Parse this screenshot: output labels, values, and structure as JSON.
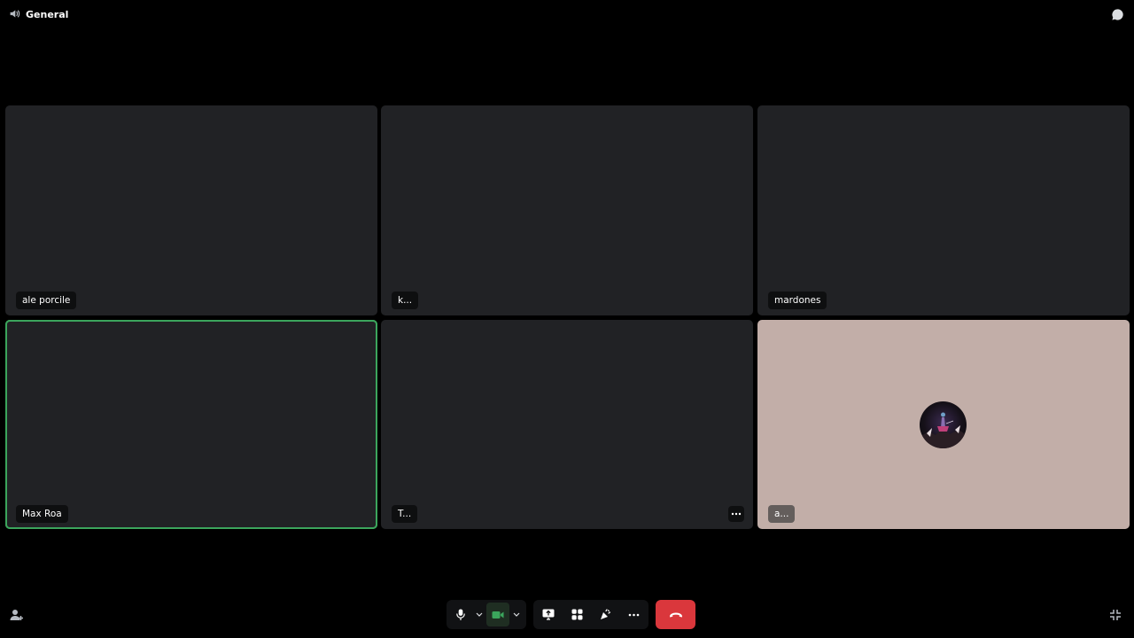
{
  "header": {
    "channel_name": "General",
    "channel_icon": "speaker-icon",
    "chat_icon": "chat-bubble-icon"
  },
  "participants": [
    {
      "name": "ale porcile",
      "speaking": false,
      "has_avatar": false
    },
    {
      "name": "k...",
      "speaking": false,
      "has_avatar": false
    },
    {
      "name": "mardones",
      "speaking": false,
      "has_avatar": false
    },
    {
      "name": "Max Roa",
      "speaking": true,
      "has_avatar": false
    },
    {
      "name": "T...",
      "speaking": false,
      "has_avatar": false,
      "more_menu": "more-icon"
    },
    {
      "name": "a...",
      "speaking": false,
      "has_avatar": true
    }
  ],
  "controls": {
    "buttons": [
      "microphone-icon",
      "chevron-down-icon",
      "video-camera-icon",
      "chevron-down-icon",
      "screen-share-icon",
      "activities-icon",
      "soundboard-icon",
      "more-icon",
      "hang-up-icon"
    ]
  },
  "colors": {
    "speaking_outline": "#3ba55c",
    "tile_background": "#212225",
    "avatar_tile_background": "#c2aea8",
    "hang_up": "#da373c",
    "video_on": "#3ba55c"
  },
  "footer": {
    "left_icon": "add-person-icon",
    "right_icon": "exit-fullscreen-icon"
  }
}
